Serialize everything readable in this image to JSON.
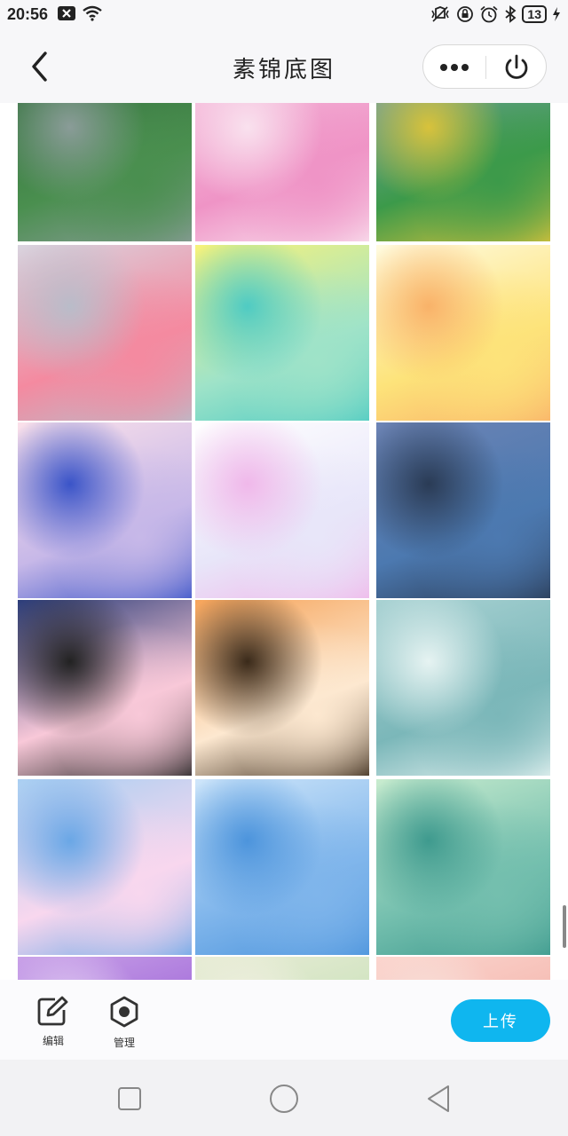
{
  "status_bar": {
    "time": "20:56",
    "battery": "13",
    "left_icons": [
      "close-box-icon",
      "wifi-icon"
    ],
    "right_icons": [
      "vibrate-icon",
      "rotation-lock-icon",
      "alarm-icon",
      "bluetooth-icon",
      "battery-icon",
      "charging-icon"
    ]
  },
  "header": {
    "title": "素锦底图"
  },
  "toolbar": {
    "edit_label": "编辑",
    "manage_label": "管理",
    "upload_label": "上传"
  },
  "colors": {
    "accent": "#0fb6ef",
    "background": "#f7f7f9"
  },
  "grid": {
    "columns": 3,
    "tiles": [
      {
        "name": "green-galaxy-watercolor",
        "colors": [
          "#2f6a3a",
          "#4a8f4f",
          "#8a9c98"
        ]
      },
      {
        "name": "pink-marble-watercolor",
        "colors": [
          "#f6c3df",
          "#ef94c6",
          "#f9e1ee"
        ]
      },
      {
        "name": "rainbow-splatter-watercolor",
        "colors": [
          "#7fa1b8",
          "#3c9a4a",
          "#d8c23b"
        ]
      },
      {
        "name": "grey-pink-cloud-watercolor",
        "colors": [
          "#d9d4df",
          "#f48aa0",
          "#b9bcc9"
        ]
      },
      {
        "name": "yellow-swirl-watercolor",
        "colors": [
          "#f7f27a",
          "#9fe3c8",
          "#4fcbc3"
        ]
      },
      {
        "name": "yellow-orange-glow-watercolor",
        "colors": [
          "#fffbe0",
          "#fde37a",
          "#f9b269"
        ]
      },
      {
        "name": "pink-blue-gradient-watercolor",
        "colors": [
          "#fbe1ea",
          "#c7b8e8",
          "#3a54c8"
        ]
      },
      {
        "name": "pale-city-skyline",
        "colors": [
          "#ffffff",
          "#e8e6f9",
          "#f0b8ea"
        ]
      },
      {
        "name": "ocean-girl-on-rocks",
        "colors": [
          "#6d84b5",
          "#4c79b0",
          "#2a3b55"
        ]
      },
      {
        "name": "night-cloud-building",
        "colors": [
          "#2b3c78",
          "#f8c8d8",
          "#222222"
        ]
      },
      {
        "name": "orange-cloud-trees",
        "colors": [
          "#f6a45a",
          "#fde8d0",
          "#3a2a1a"
        ]
      },
      {
        "name": "teal-floral-watercolor",
        "colors": [
          "#a9d2d3",
          "#7bb7b9",
          "#e6f3f2"
        ]
      },
      {
        "name": "blue-pink-sky-watercolor",
        "colors": [
          "#a9cff2",
          "#f8d7ee",
          "#6aa7e6"
        ]
      },
      {
        "name": "light-blue-splash-watercolor",
        "colors": [
          "#cfe6fa",
          "#7fb5eb",
          "#4c94dc"
        ]
      },
      {
        "name": "mint-teal-watercolor",
        "colors": [
          "#c9eccf",
          "#74bfae",
          "#3e9a8e"
        ]
      },
      {
        "name": "purple-watercolor-partial",
        "colors": [
          "#c9a2e8",
          "#9b61d6",
          "#e7d6f5"
        ]
      },
      {
        "name": "pastel-green-partial",
        "colors": [
          "#e8ecd6",
          "#c6e0b7",
          "#f5f2e6"
        ]
      },
      {
        "name": "peach-pink-partial",
        "colors": [
          "#fbd6cf",
          "#f3b1a8",
          "#f7e6e0"
        ]
      }
    ]
  }
}
